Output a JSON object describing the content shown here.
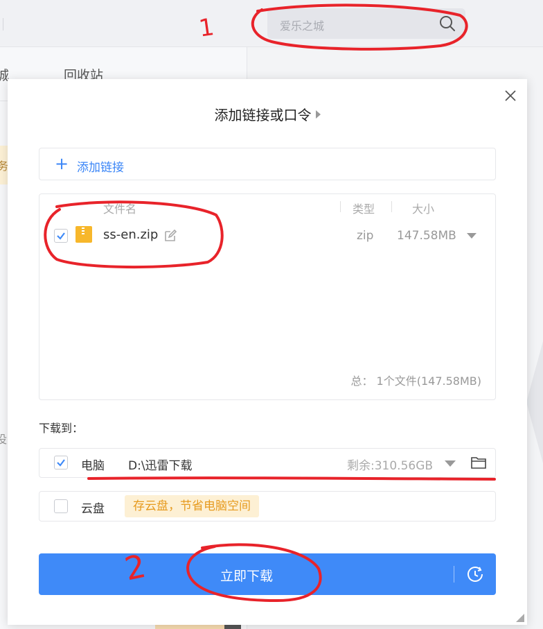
{
  "background": {
    "search_placeholder": "爱乐之城",
    "tab_1_fragment": "城",
    "tab_2": "回收站",
    "side_fragment_1": "务",
    "side_fragment_2": "没"
  },
  "dialog": {
    "title": "添加链接或口令",
    "add_link_label": "添加链接",
    "columns": {
      "name": "文件名",
      "type": "类型",
      "size": "大小"
    },
    "files": [
      {
        "name": "ss-en.zip",
        "type": "zip",
        "size": "147.58MB",
        "checked": true
      }
    ],
    "total": "总： 1个文件(147.58MB)",
    "download_to_label": "下载到：",
    "destination": {
      "name": "电脑",
      "path": "D:\\迅雷下载",
      "free_space": "剩余:310.56GB",
      "checked": true
    },
    "cloud": {
      "name": "云盘",
      "tip": "存云盘，节省电脑空间",
      "checked": false
    },
    "download_button": "立即下载"
  },
  "colors": {
    "accent": "#3f8af8",
    "annotation": "#e8232a",
    "tip_bg": "#fdf0d4",
    "tip_text": "#e69a1e"
  },
  "annotations": [
    "1",
    "2"
  ]
}
